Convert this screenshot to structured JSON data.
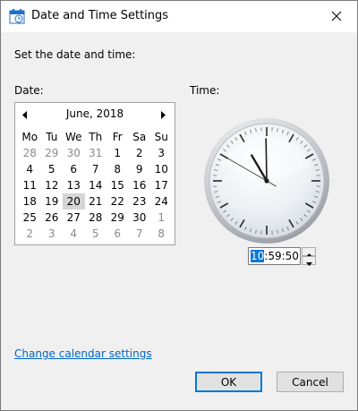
{
  "window": {
    "title": "Date and Time Settings",
    "title_icon": "date-time-settings-icon",
    "close_icon": "close-icon"
  },
  "heading": "Set the date and time:",
  "date_section": {
    "label": "Date:",
    "calendar": {
      "month_label": "June, 2018",
      "prev_icon": "triangle-left-icon",
      "next_icon": "triangle-right-icon",
      "weekdays": [
        "Mo",
        "Tu",
        "We",
        "Th",
        "Fr",
        "Sa",
        "Su"
      ],
      "weeks": [
        [
          {
            "d": "28",
            "o": true
          },
          {
            "d": "29",
            "o": true
          },
          {
            "d": "30",
            "o": true
          },
          {
            "d": "31",
            "o": true
          },
          {
            "d": "1"
          },
          {
            "d": "2"
          },
          {
            "d": "3"
          }
        ],
        [
          {
            "d": "4"
          },
          {
            "d": "5"
          },
          {
            "d": "6"
          },
          {
            "d": "7"
          },
          {
            "d": "8"
          },
          {
            "d": "9"
          },
          {
            "d": "10"
          }
        ],
        [
          {
            "d": "11"
          },
          {
            "d": "12"
          },
          {
            "d": "13"
          },
          {
            "d": "14"
          },
          {
            "d": "15"
          },
          {
            "d": "16"
          },
          {
            "d": "17"
          }
        ],
        [
          {
            "d": "18"
          },
          {
            "d": "19"
          },
          {
            "d": "20",
            "s": true
          },
          {
            "d": "21"
          },
          {
            "d": "22"
          },
          {
            "d": "23"
          },
          {
            "d": "24"
          }
        ],
        [
          {
            "d": "25"
          },
          {
            "d": "26"
          },
          {
            "d": "27"
          },
          {
            "d": "28"
          },
          {
            "d": "29"
          },
          {
            "d": "30"
          },
          {
            "d": "1",
            "o": true
          }
        ],
        [
          {
            "d": "2",
            "o": true
          },
          {
            "d": "3",
            "o": true
          },
          {
            "d": "4",
            "o": true
          },
          {
            "d": "5",
            "o": true
          },
          {
            "d": "6",
            "o": true
          },
          {
            "d": "7",
            "o": true
          },
          {
            "d": "8",
            "o": true
          }
        ]
      ],
      "selected_color": "#d6d6d6",
      "other_month_color": "#8a8a8a"
    }
  },
  "time_section": {
    "label": "Time:",
    "clock": {
      "hours": 10,
      "minutes": 59,
      "seconds": 50
    },
    "hour_text": "10",
    "rest_text": ":59:50",
    "spin_up_icon": "spin-up-arrow-icon",
    "spin_down_icon": "spin-down-arrow-icon",
    "selection_color": "#0078d7"
  },
  "link": {
    "label": "Change calendar settings",
    "color": "#0066cc"
  },
  "buttons": {
    "ok_label": "OK",
    "cancel_label": "Cancel",
    "default_border_color": "#0078d7"
  }
}
